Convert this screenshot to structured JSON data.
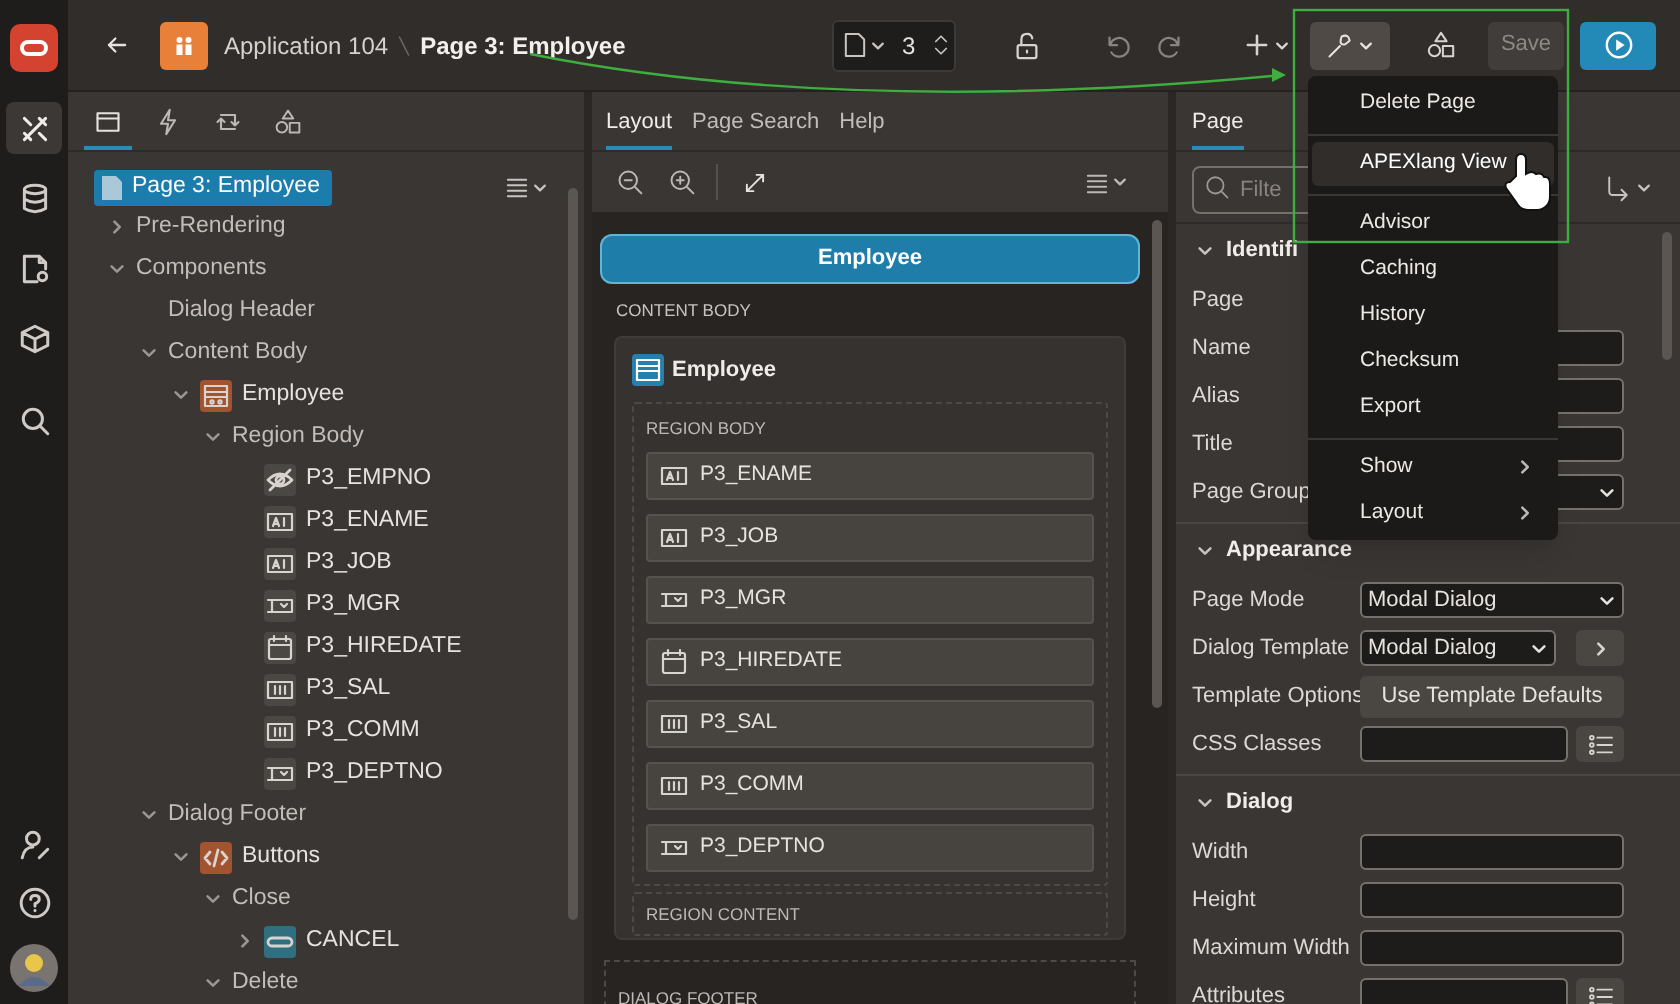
{
  "topbar": {
    "app": "Application 104",
    "page": "Page 3: Employee",
    "page_number": "3",
    "save": "Save"
  },
  "rail": [
    {
      "selected": true
    },
    {
      "selected": false
    },
    {
      "selected": false
    },
    {
      "selected": false
    },
    {
      "selected": false
    }
  ],
  "tree": {
    "tabs": [
      {
        "selected": true
      },
      {
        "selected": false
      },
      {
        "selected": false
      },
      {
        "selected": false
      }
    ],
    "root": {
      "label": "Page 3: Employee",
      "selected": true
    },
    "nodes": [
      {
        "label": "Pre-Rendering",
        "expanded": false
      },
      {
        "label": "Components",
        "expanded": true,
        "children": [
          {
            "label": "Dialog Header"
          },
          {
            "label": "Content Body",
            "expanded": true,
            "children": [
              {
                "label": "Employee",
                "kind": "region",
                "expanded": true,
                "children": [
                  {
                    "label": "Region Body",
                    "expanded": true,
                    "children": [
                      {
                        "label": "P3_EMPNO",
                        "kind": "hidden"
                      },
                      {
                        "label": "P3_ENAME",
                        "kind": "text_field"
                      },
                      {
                        "label": "P3_JOB",
                        "kind": "text_field"
                      },
                      {
                        "label": "P3_MGR",
                        "kind": "select_list"
                      },
                      {
                        "label": "P3_HIREDATE",
                        "kind": "date_picker"
                      },
                      {
                        "label": "P3_SAL",
                        "kind": "number_field"
                      },
                      {
                        "label": "P3_COMM",
                        "kind": "number_field"
                      },
                      {
                        "label": "P3_DEPTNO",
                        "kind": "select_list"
                      }
                    ]
                  }
                ]
              }
            ]
          },
          {
            "label": "Dialog Footer",
            "expanded": true,
            "children": [
              {
                "label": "Buttons",
                "kind": "buttons",
                "expanded": true,
                "children": [
                  {
                    "label": "Close",
                    "expanded": true,
                    "children": [
                      {
                        "label": "CANCEL",
                        "kind": "button",
                        "expanded": false
                      }
                    ]
                  },
                  {
                    "label": "Delete",
                    "expanded": true
                  }
                ]
              }
            ]
          }
        ]
      }
    ]
  },
  "layout": {
    "tabs": [
      {
        "label": "Layout",
        "selected": true
      },
      {
        "label": "Page Search",
        "selected": false
      },
      {
        "label": "Help",
        "selected": false
      }
    ],
    "page_bar": "Employee",
    "content_label": "CONTENT BODY",
    "region": {
      "title": "Employee",
      "body_label": "REGION BODY",
      "items": [
        {
          "label": "P3_ENAME",
          "kind": "text_field"
        },
        {
          "label": "P3_JOB",
          "kind": "text_field"
        },
        {
          "label": "P3_MGR",
          "kind": "select_list"
        },
        {
          "label": "P3_HIREDATE",
          "kind": "date_picker"
        },
        {
          "label": "P3_SAL",
          "kind": "number_field"
        },
        {
          "label": "P3_COMM",
          "kind": "number_field"
        },
        {
          "label": "P3_DEPTNO",
          "kind": "select_list"
        }
      ],
      "content_label": "REGION CONTENT"
    },
    "footer_label": "DIALOG FOOTER"
  },
  "properties": {
    "tab": {
      "label": "Page",
      "selected": true
    },
    "filter": {
      "placeholder": "Filte"
    },
    "sections": [
      {
        "title": "Identifi",
        "expanded": true,
        "rows": [
          {
            "label": "Page",
            "kind": "label"
          },
          {
            "label": "Name",
            "kind": "text"
          },
          {
            "label": "Alias",
            "kind": "text"
          },
          {
            "label": "Title",
            "kind": "text"
          },
          {
            "label": "Page Group",
            "kind": "select"
          }
        ]
      },
      {
        "title": "Appearance",
        "expanded": true,
        "rows": [
          {
            "label": "Page Mode",
            "kind": "select",
            "value": "Modal Dialog"
          },
          {
            "label": "Dialog Template",
            "kind": "select_next",
            "value": "Modal Dialog"
          },
          {
            "label": "Template Options",
            "kind": "button",
            "value": "Use Template Defaults"
          },
          {
            "label": "CSS Classes",
            "kind": "text_list"
          }
        ]
      },
      {
        "title": "Dialog",
        "expanded": true,
        "rows": [
          {
            "label": "Width",
            "kind": "text"
          },
          {
            "label": "Height",
            "kind": "text"
          },
          {
            "label": "Maximum Width",
            "kind": "text"
          },
          {
            "label": "Attributes",
            "kind": "text_list"
          }
        ]
      }
    ]
  },
  "menu": {
    "items": [
      {
        "label": "Delete Page",
        "selected": false,
        "submenu": false,
        "divider_after": true
      },
      {
        "label": "APEXlang View",
        "selected": true,
        "submenu": false,
        "divider_after": true
      },
      {
        "label": "Advisor",
        "selected": false,
        "submenu": false,
        "divider_after": false
      },
      {
        "label": "Caching",
        "selected": false,
        "submenu": false,
        "divider_after": false
      },
      {
        "label": "History",
        "selected": false,
        "submenu": false,
        "divider_after": false
      },
      {
        "label": "Checksum",
        "selected": false,
        "submenu": false,
        "divider_after": false
      },
      {
        "label": "Export",
        "selected": false,
        "submenu": false,
        "divider_after": true
      },
      {
        "label": "Show",
        "selected": false,
        "submenu": true,
        "divider_after": false
      },
      {
        "label": "Layout",
        "selected": false,
        "submenu": true,
        "divider_after": false
      }
    ]
  }
}
